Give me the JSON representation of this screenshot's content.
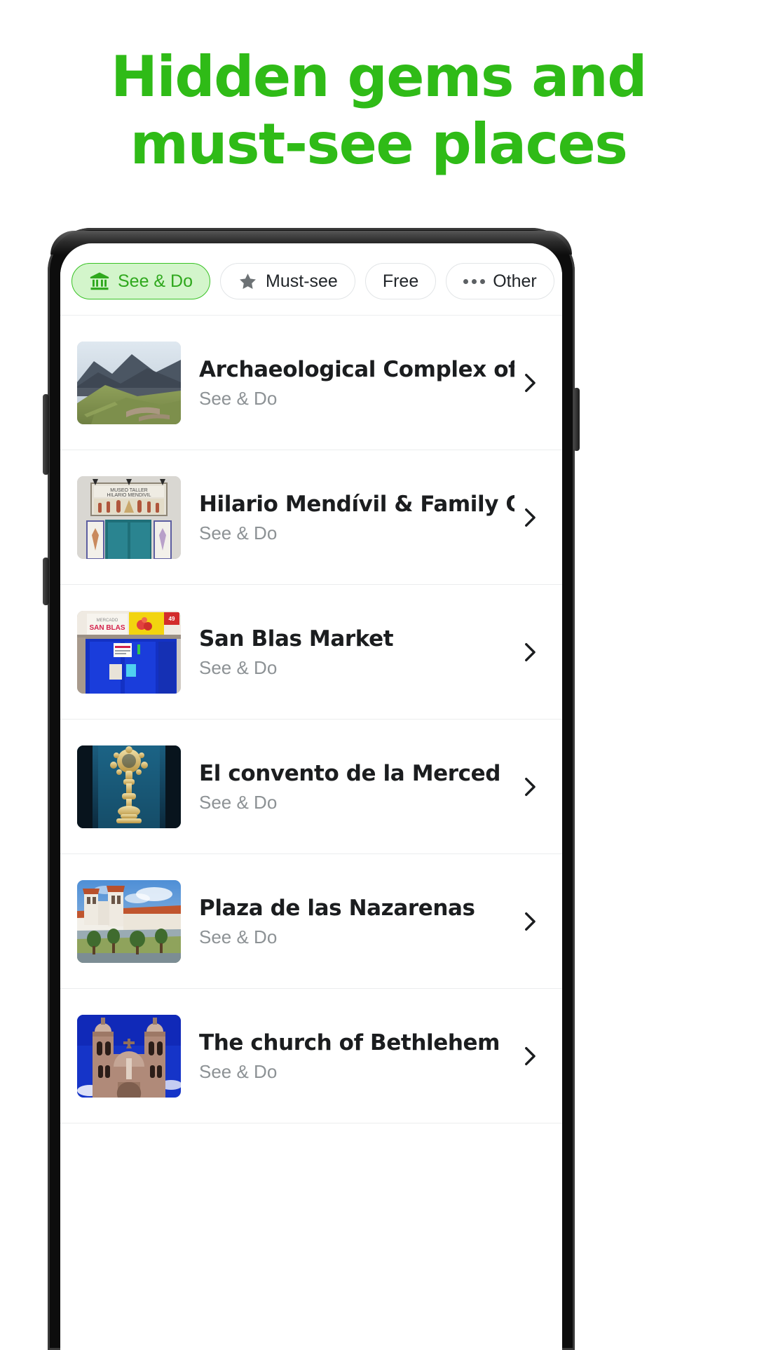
{
  "headline": {
    "line1": "Hidden gems and",
    "line2": "must-see places",
    "color": "#2fbb17"
  },
  "colors": {
    "accent_green": "#2fbb17",
    "chip_active_bg": "#d3f5cb",
    "chip_active_border": "#39c225",
    "chip_active_text": "#2fa81d",
    "chip_border": "#e2e5e7",
    "title_text": "#1b1d1f",
    "subtitle_text": "#8d9295",
    "divider": "#ebedee"
  },
  "filters": [
    {
      "label": "See & Do",
      "icon": "museum-icon",
      "active": true
    },
    {
      "label": "Must-see",
      "icon": "star-icon",
      "active": false
    },
    {
      "label": "Free",
      "icon": "none",
      "active": false
    },
    {
      "label": "Other",
      "icon": "ellipsis-icon",
      "active": false
    }
  ],
  "list": {
    "items": [
      {
        "title": "Archaeological Complex of Pisac",
        "subtitle": "See & Do",
        "thumb": "pisac-terraces-photo",
        "chevron": "chevron-right-icon"
      },
      {
        "title": "Hilario Mendívil & Family Gallery",
        "subtitle": "See & Do",
        "thumb": "mendivil-museum-facade-photo",
        "chevron": "chevron-right-icon"
      },
      {
        "title": "San Blas Market",
        "subtitle": "See & Do",
        "thumb": "san-blas-market-photo",
        "chevron": "chevron-right-icon"
      },
      {
        "title": "El convento de la Merced",
        "subtitle": "See & Do",
        "thumb": "merced-monstrance-photo",
        "chevron": "chevron-right-icon"
      },
      {
        "title": "Plaza de las Nazarenas",
        "subtitle": "See & Do",
        "thumb": "plaza-nazarenas-photo",
        "chevron": "chevron-right-icon"
      },
      {
        "title": "The church of Bethlehem",
        "subtitle": "See & Do",
        "thumb": "bethlehem-church-photo",
        "chevron": "chevron-right-icon"
      }
    ]
  }
}
